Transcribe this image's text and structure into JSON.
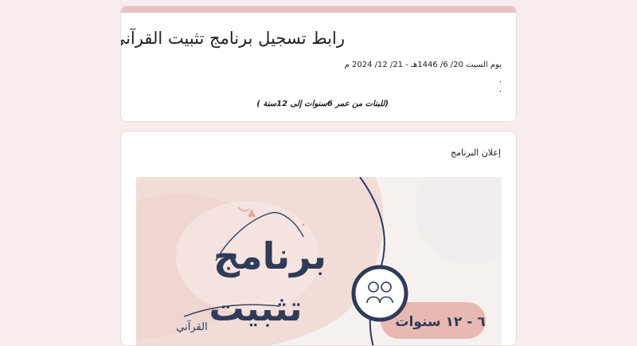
{
  "form": {
    "title": "رابط تسجيل برنامج تثبيت القرآني",
    "date_line": "يوم السبت 20/ 6/ 1446هـ - 21/ 12/ 2024 م",
    "dot_1": ".",
    "dot_2": ".",
    "age_note": "(للبنات من عمر 6سنوات إلى 12سنة )"
  },
  "section": {
    "label": "إعلان البرنامج"
  },
  "poster": {
    "title_line_1": "برنامج",
    "title_line_2": "تثبيت",
    "title_line_3": "القرآني",
    "age_badge": "٦ - ١٢ سنوات",
    "icon": "girls-icon"
  },
  "colors": {
    "page_bg": "#f8ecec",
    "accent": "#e8c1c1",
    "poster_bg": "#f4e4e0",
    "poster_navy": "#2f3b58",
    "poster_pink": "#e8b9b3"
  }
}
